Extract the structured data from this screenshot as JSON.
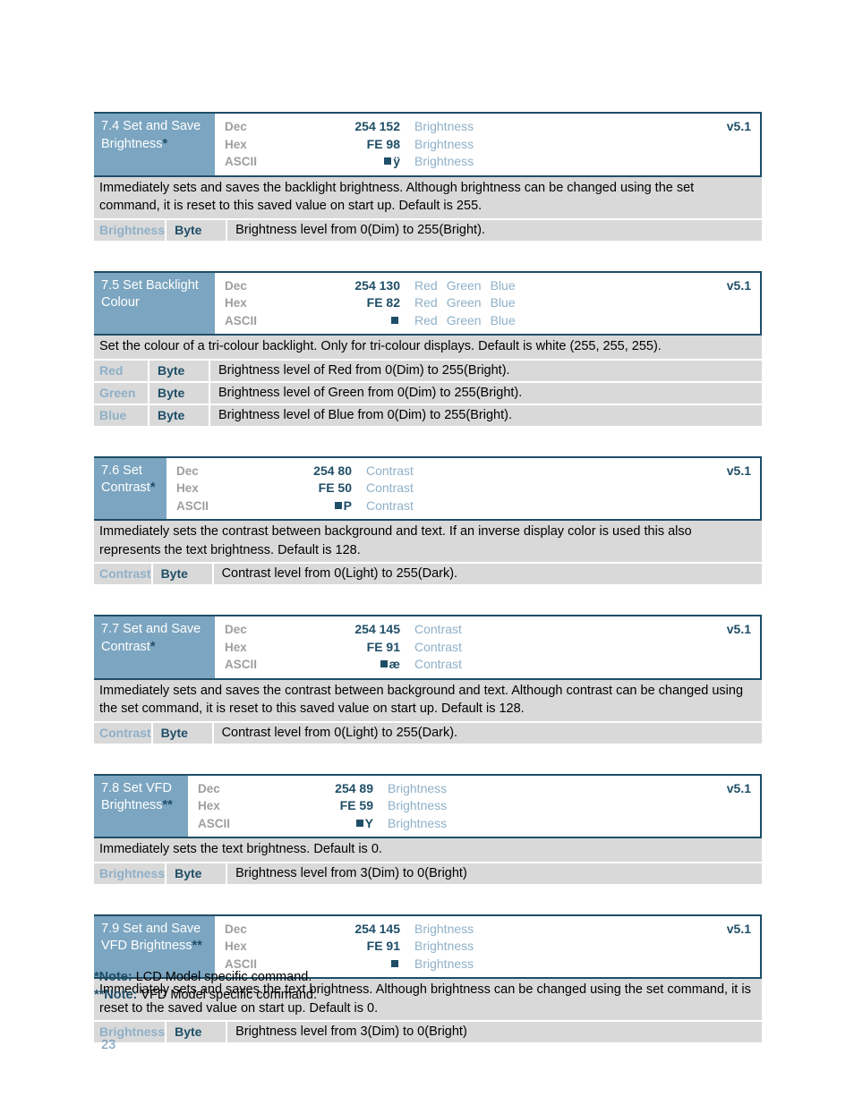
{
  "page": {
    "number": "23",
    "notes": [
      {
        "marker": "*Note:",
        "text": " LCD Model specific command."
      },
      {
        "marker": "**Note:",
        "text": " VFD Model specific command."
      }
    ]
  },
  "colors": {
    "header_bg": "#7ba5c0",
    "dark_blue": "#1f4e67",
    "light_blue_text": "#8fb0c8",
    "grey_row": "#d9d9d9",
    "label_grey": "#9e9e9e"
  },
  "labels": {
    "dec": "Dec",
    "hex": "Hex",
    "ascii": "ASCII"
  },
  "blocks": [
    {
      "name_line1": "7.4 Set and Save",
      "name_line2": "Brightness",
      "name_suffix": "*",
      "name_width": 135,
      "value_width": 135,
      "version": "v5.1",
      "dec": "254 152",
      "hex": "FE 98",
      "ascii": "■ ÿ",
      "args": [
        "Brightness"
      ],
      "description": "Immediately sets and saves the backlight brightness.  Although brightness can be changed using the set command, it is reset to this saved value on start up.  Default is 255.",
      "params": [
        {
          "name": "Brightness",
          "type": "Byte",
          "desc": "Brightness level from 0(Dim) to 255(Bright)."
        }
      ]
    },
    {
      "name_line1": "7.5 Set Backlight",
      "name_line2": "Colour",
      "name_suffix": "",
      "name_width": 135,
      "value_width": 135,
      "version": "v5.1",
      "dec": "254 130",
      "hex": "FE 82",
      "ascii": "■",
      "args": [
        "Red",
        "Green",
        "Blue"
      ],
      "description": "Set the colour of a tri-colour backlight.  Only for tri-colour displays.  Default is white (255, 255, 255).",
      "params": [
        {
          "name": "Red",
          "type": "Byte",
          "desc": "Brightness level of Red from 0(Dim) to 255(Bright)."
        },
        {
          "name": "Green",
          "type": "Byte",
          "desc": "Brightness level of Green from 0(Dim) to 255(Bright)."
        },
        {
          "name": "Blue",
          "type": "Byte",
          "desc": "Brightness level of Blue from 0(Dim) to 255(Bright)."
        }
      ]
    },
    {
      "name_line1": "7.6 Set",
      "name_line2": "Contrast",
      "name_suffix": "*",
      "name_width": 81,
      "value_width": 135,
      "version": "v5.1",
      "dec": "254 80",
      "hex": "FE 50",
      "ascii": "■ P",
      "args": [
        "Contrast"
      ],
      "description": "Immediately sets the contrast between background and text.  If an inverse display color is used this also represents the text brightness.  Default is 128.",
      "params": [
        {
          "name": "Contrast",
          "type": "Byte",
          "desc": "Contrast level from 0(Light) to 255(Dark)."
        }
      ]
    },
    {
      "name_line1": "7.7 Set and Save",
      "name_line2": "Contrast",
      "name_suffix": "*",
      "name_width": 135,
      "value_width": 135,
      "version": "v5.1",
      "dec": "254 145",
      "hex": "FE 91",
      "ascii": "■ æ",
      "args": [
        "Contrast"
      ],
      "description": "Immediately sets and saves the contrast between background and text.  Although contrast can be changed using the set command, it is reset to this saved value on start up.  Default is 128.",
      "params": [
        {
          "name": "Contrast",
          "type": "Byte",
          "desc": "Contrast level from 0(Light) to 255(Dark)."
        }
      ]
    },
    {
      "name_line1": "7.8 Set VFD",
      "name_line2": "Brightness",
      "name_suffix": "**",
      "name_width": 105,
      "value_width": 135,
      "version": "v5.1",
      "dec": "254 89",
      "hex": "FE 59",
      "ascii": "■ Y",
      "args": [
        "Brightness"
      ],
      "description": "Immediately sets the text brightness.  Default is 0.",
      "params": [
        {
          "name": "Brightness",
          "type": "Byte",
          "desc": "Brightness level from 3(Dim) to 0(Bright)"
        }
      ]
    },
    {
      "name_line1": "7.9 Set and Save",
      "name_line2": "VFD Brightness",
      "name_suffix": "**",
      "name_width": 135,
      "value_width": 135,
      "version": "v5.1",
      "dec": "254 145",
      "hex": "FE 91",
      "ascii": "■",
      "args": [
        "Brightness"
      ],
      "description": "Immediately sets and saves the text brightness.  Although brightness can be changed using the set command, it is reset to the saved value on start up.  Default is 0.",
      "params": [
        {
          "name": "Brightness",
          "type": "Byte",
          "desc": "Brightness level from 3(Dim) to 0(Bright)"
        }
      ]
    }
  ]
}
